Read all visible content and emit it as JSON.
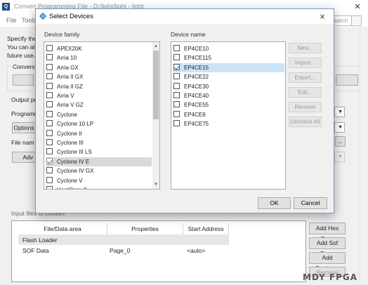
{
  "main_window": {
    "title": "Convert Programming File - D:/light/light - light",
    "menu": [
      "File",
      "Tools"
    ],
    "search_placeholder": "Search",
    "intro_lines": [
      "Specify the",
      "You can als",
      "future use."
    ],
    "labels": {
      "conversion": "Conversi",
      "output": "Output pr",
      "programming": "Programm",
      "file_name": "File nam",
      "options_button": "Options",
      "advanced_button": "Adv",
      "input_files": "Input files to convert",
      "browse_button": "..."
    },
    "table": {
      "columns": [
        "File/Data area",
        "Properties",
        "Start Address"
      ],
      "group_row": "Flash Loader",
      "rows": [
        {
          "file": "SOF Data",
          "properties": "Page_0",
          "address": "<auto>"
        }
      ]
    },
    "side_buttons": [
      "Add Hex Data",
      "Add Sof Page",
      "Add Device...",
      "Remove"
    ]
  },
  "dialog": {
    "title": "Select Devices",
    "close_glyph": "×",
    "family_label": "Device family",
    "device_label": "Device name",
    "families": [
      {
        "label": "APEX20K",
        "checked": false
      },
      {
        "label": "Arria 10",
        "checked": false
      },
      {
        "label": "Arria GX",
        "checked": false
      },
      {
        "label": "Arria II GX",
        "checked": false
      },
      {
        "label": "Arria II GZ",
        "checked": false
      },
      {
        "label": "Arria V",
        "checked": false
      },
      {
        "label": "Arria V GZ",
        "checked": false
      },
      {
        "label": "Cyclone",
        "checked": false
      },
      {
        "label": "Cyclone 10 LP",
        "checked": false
      },
      {
        "label": "Cyclone II",
        "checked": false
      },
      {
        "label": "Cyclone III",
        "checked": false
      },
      {
        "label": "Cyclone III LS",
        "checked": false
      },
      {
        "label": "Cyclone IV E",
        "checked": true
      },
      {
        "label": "Cyclone IV GX",
        "checked": false
      },
      {
        "label": "Cyclone V",
        "checked": false
      },
      {
        "label": "HardCopy II",
        "checked": false
      }
    ],
    "devices": [
      {
        "label": "EP4CE10",
        "checked": false
      },
      {
        "label": "EP4CE115",
        "checked": false
      },
      {
        "label": "EP4CE15",
        "checked": true
      },
      {
        "label": "EP4CE22",
        "checked": false
      },
      {
        "label": "EP4CE30",
        "checked": false
      },
      {
        "label": "EP4CE40",
        "checked": false
      },
      {
        "label": "EP4CE55",
        "checked": false
      },
      {
        "label": "EP4CE6",
        "checked": false
      },
      {
        "label": "EP4CE75",
        "checked": false
      }
    ],
    "action_buttons": [
      "New...",
      "Import...",
      "Export...",
      "Edit...",
      "Remove",
      "Uncheck All"
    ],
    "ok_label": "OK",
    "cancel_label": "Cancel"
  },
  "watermark": "MDY FPGA",
  "colors": {
    "selection_blue": "#cce4f7",
    "check_blue": "#2a6ebb",
    "dialog_border": "#7a9cc6"
  }
}
